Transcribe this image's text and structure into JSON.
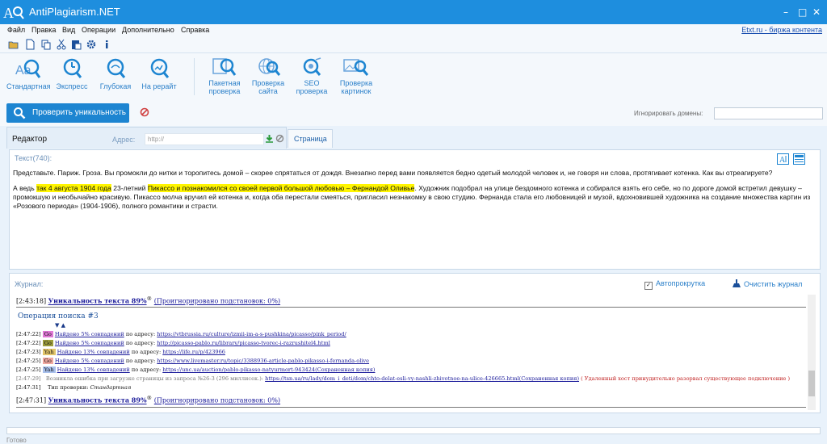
{
  "titlebar": {
    "title": "AntiPlagiarism.NET",
    "minimize": "–",
    "maximize": "□",
    "close": "✕"
  },
  "menu": {
    "items": [
      "Файл",
      "Правка",
      "Вид",
      "Операции",
      "Дополнительно",
      "Справка"
    ],
    "right_link": "Etxt.ru - биржа контента"
  },
  "ribbon": {
    "buttons": [
      "Стандартная",
      "Экспресс",
      "Глубокая",
      "На рерайт"
    ],
    "buttons2": [
      {
        "line1": "Пакетная",
        "line2": "проверка"
      },
      {
        "line1": "Проверка",
        "line2": "сайта"
      },
      {
        "line1": "SEO",
        "line2": "проверка"
      },
      {
        "line1": "Проверка",
        "line2": "картинок"
      }
    ]
  },
  "action": {
    "check_button": "Проверить уникальность",
    "ignore_label": "Игнорировать домены:"
  },
  "editor": {
    "tab_label": "Редактор",
    "address_label": "Адрес:",
    "address_placeholder": "http://",
    "page_tab": "Страница"
  },
  "text_panel": {
    "header": "Текст(740):",
    "p1": "Представьте. Париж. Гроза. Вы промокли до нитки и торопитесь домой – скорее спрятаться от дождя. Внезапно перед вами появляется бедно одетый молодой человек и, не говоря ни слова, протягивает котенка. Как вы отреагируете?",
    "p2_a": "А ведь ",
    "p2_hl1": "так 4 августа 1904 года",
    "p2_b": " 23-летний ",
    "p2_hl2": "Пикассо и познакомился со своей первой большой любовью – Фернандой Оливье",
    "p2_c": ". Художник подобрал на улице бездомного котенка и собирался взять его себе, но по дороге домой встретил девушку – промокшую и необычайно красивую. Пикассо молча вручил ей котенка и, когда оба перестали смеяться, пригласил незнакомку в свою студию. Фернанда стала его любовницей и музой, вдохновившей художника на создание множества картин из «Розового периода» (1904-1906), полного романтики и страсти."
  },
  "log": {
    "header": "Журнал:",
    "autoscroll": "Автопрокрутка",
    "clear": "Очистить журнал",
    "uniq1": {
      "time": "[2:43:18]",
      "text": "Уникальность текста 89%",
      "sup": "®",
      "ignored": "(Проигнорировано подстановок: 0%)"
    },
    "op_header": "Операция поиска #3",
    "arrows": "▼ ▲",
    "rows": [
      {
        "time": "[2:47:22]",
        "tag": "Go",
        "tag_bg": "#e079d6",
        "found": "Найдено 5% совпадений",
        "mid": " по адресу: ",
        "url": "https://vtbrussia.ru/culture/izmii-im-a-s-pushkina/picasso/pink_period/"
      },
      {
        "time": "[2:47:22]",
        "tag": "Go",
        "tag_bg": "#9c9c3c",
        "found": "Найдено 5% совпадений",
        "mid": " по адресу: ",
        "url": "http://picasso-pablo.ru/library/picasso-tvorec-i-razrushitel4.html"
      },
      {
        "time": "[2:47:23]",
        "tag": "Yah",
        "tag_bg": "#e2c56a",
        "found": "Найдено 13% совпадений",
        "mid": " по адресу: ",
        "url": "https://life.ru/p/423966"
      },
      {
        "time": "[2:47:25]",
        "tag": "Go",
        "tag_bg": "#f0a8a0",
        "found": "Найдено 5% совпадений",
        "mid": " по адресу: ",
        "url": "https://www.livemaster.ru/topic/3388936-article-pablo-pikasso-i-fernanda-olive"
      },
      {
        "time": "[2:47:25]",
        "tag": "Yah",
        "tag_bg": "#a8c0ec",
        "found": "Найдено 13% совпадений",
        "mid": " по адресу: ",
        "url": "https://unc.ua/auction/pablo-pikasso-natyurmort-943424(Сохраненная копия)"
      }
    ],
    "err_row": {
      "time": "[2:47:29]",
      "text": "Возникла ошибка при загрузке страницы из запроса №26-3 (296 миллисек.): ",
      "url": "https://tsn.ua/ru/lady/dom_i_deti/dom/chto-delat-esli-vy-nashli-zhivotnoe-na-ulice-426665.html(Сохраненная копия)",
      "err": "( Удаленный хост принудительно разорвал существующее подключение )"
    },
    "type_row": {
      "time": "[2:47:31]",
      "label": "Тип проверки: ",
      "value": "Стандартная"
    },
    "uniq2": {
      "time": "[2:47:31]",
      "text": "Уникальность текста 89%",
      "sup": "®",
      "ignored": "(Проигнорировано подстановок: 0%)"
    }
  },
  "status": {
    "text": "Готово"
  },
  "colors": {
    "accent": "#1e8ede",
    "button": "#1d85d1",
    "highlight": "#fff500"
  }
}
